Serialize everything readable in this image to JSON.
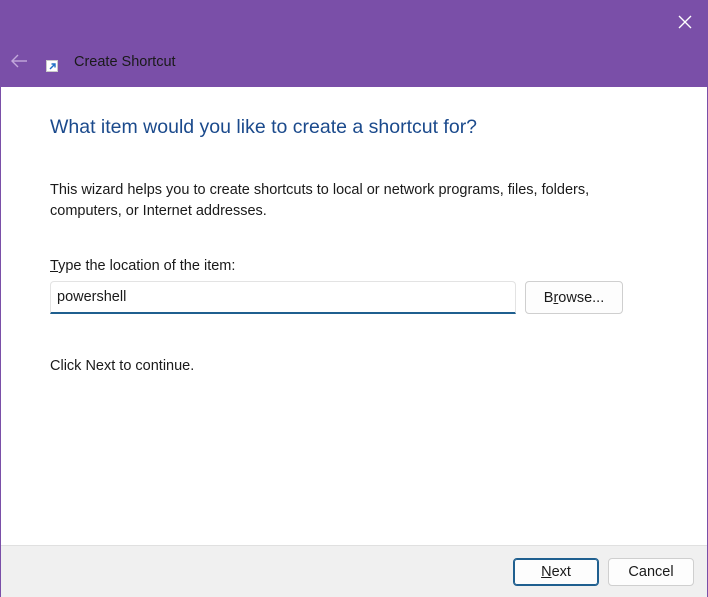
{
  "window": {
    "title": "Create Shortcut",
    "accent_color": "#7a4fa8"
  },
  "icons": {
    "close": "close-icon",
    "back": "back-arrow-icon",
    "app": "shortcut-icon"
  },
  "main": {
    "heading": "What item would you like to create a shortcut for?",
    "description": "This wizard helps you to create shortcuts to local or network programs, files, folders, computers, or Internet addresses.",
    "location_label_accel": "T",
    "location_label_rest": "ype the location of the item:",
    "location_value": "powershell",
    "browse_accel": "r",
    "browse_pre": "B",
    "browse_post": "owse...",
    "continue_text": "Click Next to continue."
  },
  "footer": {
    "next_accel": "N",
    "next_rest": "ext",
    "cancel_label": "Cancel"
  }
}
